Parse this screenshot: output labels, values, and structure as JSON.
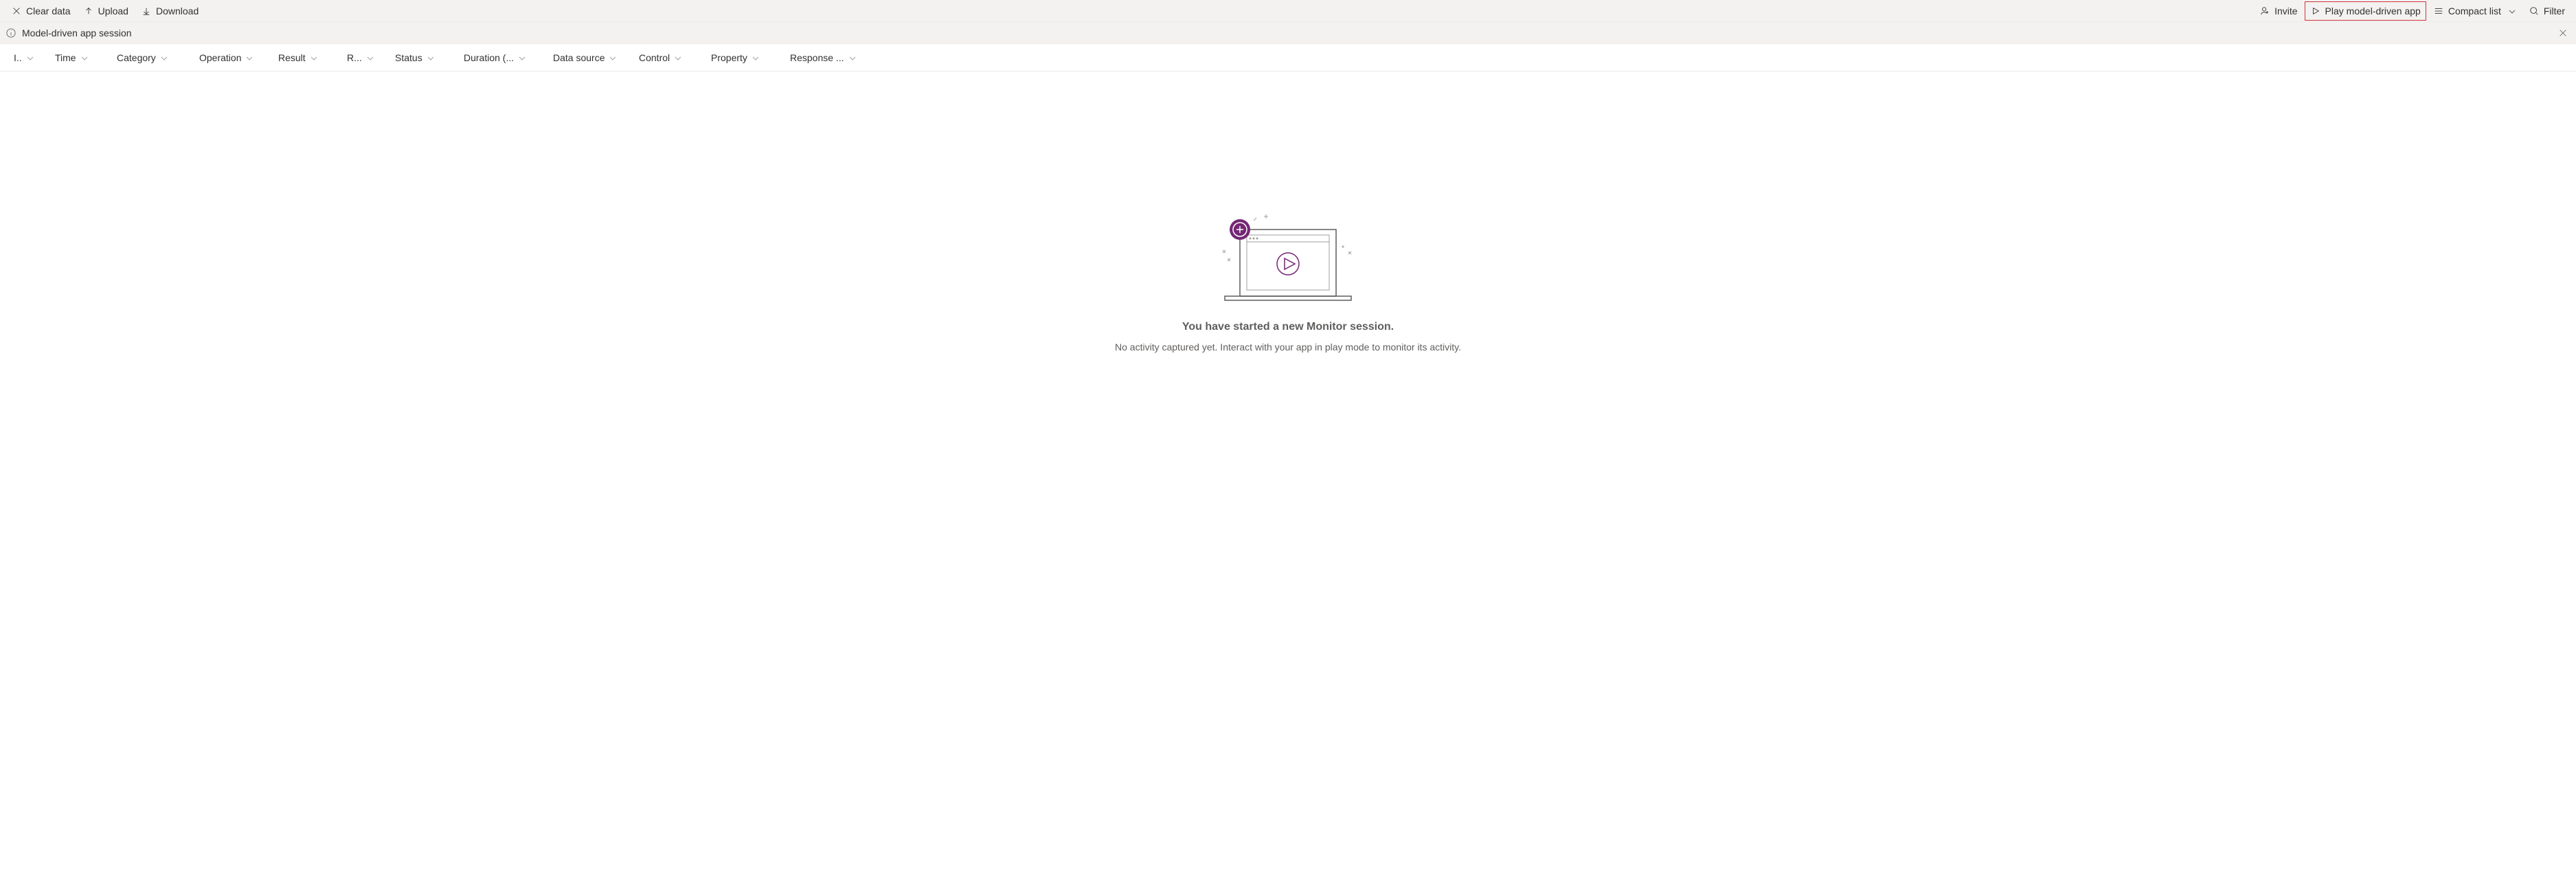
{
  "toolbar": {
    "left": {
      "clear_data": "Clear data",
      "upload": "Upload",
      "download": "Download"
    },
    "right": {
      "invite": "Invite",
      "play_app": "Play model-driven app",
      "compact_list": "Compact list",
      "filter": "Filter"
    }
  },
  "session": {
    "title": "Model-driven app session"
  },
  "columns": {
    "id": "I..",
    "time": "Time",
    "category": "Category",
    "operation": "Operation",
    "result": "Result",
    "r_col": "R...",
    "status": "Status",
    "duration": "Duration (...",
    "data_source": "Data source",
    "control": "Control",
    "property": "Property",
    "response": "Response ..."
  },
  "empty_state": {
    "title": "You have started a new Monitor session.",
    "subtitle": "No activity captured yet. Interact with your app in play mode to monitor its activity."
  },
  "colors": {
    "accent": "#742774",
    "highlight_border": "#d13438"
  }
}
